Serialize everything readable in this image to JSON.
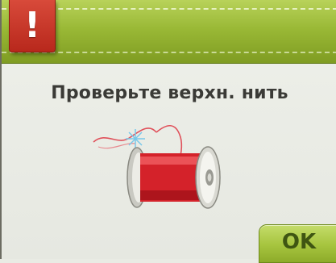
{
  "dialog": {
    "alert_symbol": "!",
    "message": "Проверьте верхн. нить",
    "ok_label": "OK"
  },
  "colors": {
    "header_green": "#9ab936",
    "alert_red": "#c8352a",
    "spool_red": "#d4222a",
    "background": "#e9ebe4"
  },
  "icons": [
    "alert-icon",
    "thread-spool-icon"
  ]
}
